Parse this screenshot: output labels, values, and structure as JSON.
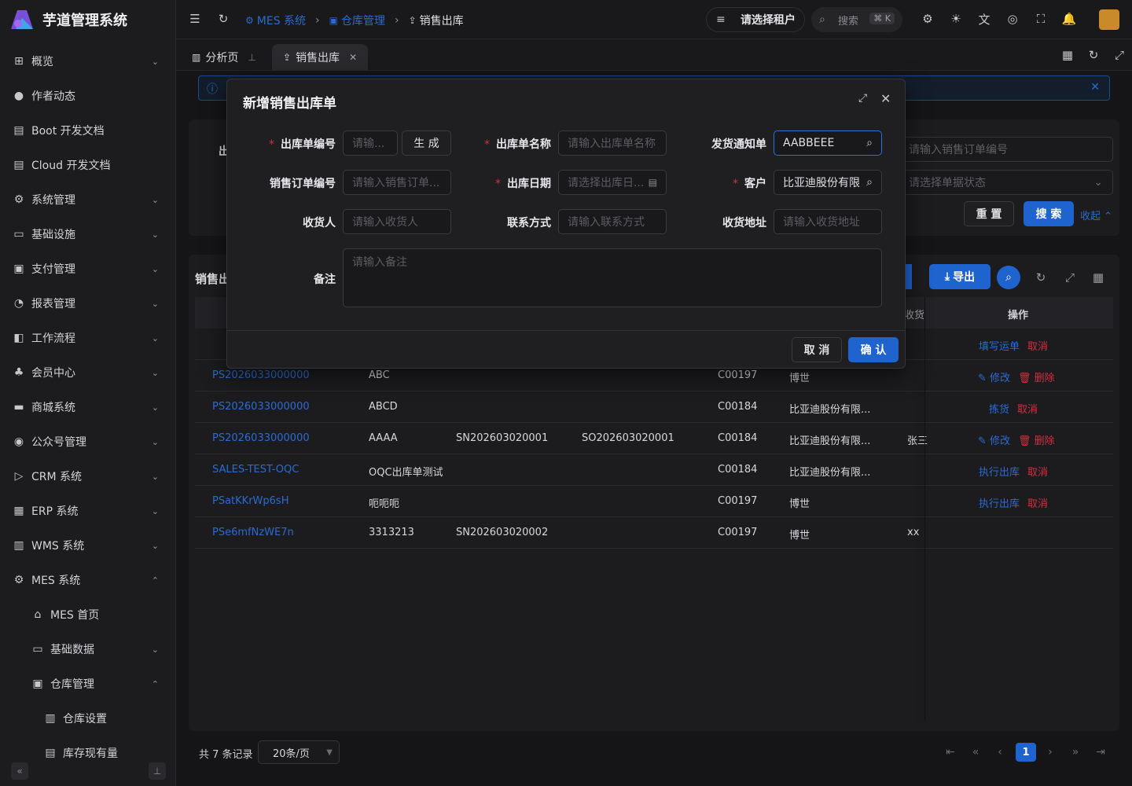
{
  "app": {
    "title": "芋道管理系统"
  },
  "sidebar": {
    "items": [
      {
        "label": "概览",
        "icon": "grid-icon",
        "chev": "⌄"
      },
      {
        "label": "作者动态",
        "icon": "user-icon",
        "chev": ""
      },
      {
        "label": "Boot 开发文档",
        "icon": "doc-icon",
        "chev": ""
      },
      {
        "label": "Cloud 开发文档",
        "icon": "doc-icon",
        "chev": ""
      },
      {
        "label": "系统管理",
        "icon": "gear-icon",
        "chev": "⌄"
      },
      {
        "label": "基础设施",
        "icon": "monitor-icon",
        "chev": "⌄"
      },
      {
        "label": "支付管理",
        "icon": "pay-icon",
        "chev": "⌄"
      },
      {
        "label": "报表管理",
        "icon": "pie-icon",
        "chev": "⌄"
      },
      {
        "label": "工作流程",
        "icon": "flow-icon",
        "chev": "⌄"
      },
      {
        "label": "会员中心",
        "icon": "users-icon",
        "chev": "⌄"
      },
      {
        "label": "商城系统",
        "icon": "shop-icon",
        "chev": "⌄"
      },
      {
        "label": "公众号管理",
        "icon": "compass-icon",
        "chev": "⌄"
      },
      {
        "label": "CRM 系统",
        "icon": "crm-icon",
        "chev": "⌄"
      },
      {
        "label": "ERP 系统",
        "icon": "erp-icon",
        "chev": "⌄"
      },
      {
        "label": "WMS 系统",
        "icon": "box-icon",
        "chev": "⌄"
      },
      {
        "label": "MES 系统",
        "icon": "chip-icon",
        "chev": "⌃"
      },
      {
        "label": "MES 首页",
        "icon": "home-icon",
        "chev": ""
      },
      {
        "label": "基础数据",
        "icon": "board-icon",
        "chev": "⌄"
      },
      {
        "label": "仓库管理",
        "icon": "warehouse-icon",
        "chev": "⌃"
      },
      {
        "label": "仓库设置",
        "icon": "building-icon",
        "chev": ""
      },
      {
        "label": "库存现有量",
        "icon": "doc-icon",
        "chev": ""
      }
    ]
  },
  "topbar": {
    "breadcrumb": [
      "MES 系统",
      "仓库管理",
      "销售出库"
    ],
    "tenant": "请选择租户",
    "search_placeholder": "搜索",
    "search_kbd": "⌘ K"
  },
  "tabs": [
    {
      "label": "分析页"
    },
    {
      "label": "销售出库"
    }
  ],
  "background": {
    "search_label_1": "出",
    "so_placeholder": "请输入销售订单编号",
    "status_placeholder": "请选择单据状态",
    "reset": "重 置",
    "search": "搜 索",
    "collapse": "收起",
    "list_title": "销售出",
    "export": "导出",
    "col_receiver": "收货",
    "col_op": "操作"
  },
  "table": {
    "rows": [
      {
        "code": "",
        "name": "",
        "notice": "",
        "so": "",
        "cust_code": "",
        "cust": "",
        "recv": "",
        "ops": [
          {
            "t": "填写运单",
            "c": "blue"
          },
          {
            "t": "取消",
            "c": "red"
          }
        ]
      },
      {
        "code": "PS2026033000000",
        "name": "ABC",
        "notice": "",
        "so": "",
        "cust_code": "C00197",
        "cust": "博世",
        "recv": "",
        "ops": [
          {
            "t": "✎ 修改",
            "c": "blue"
          },
          {
            "t": "🗑 删除",
            "c": "red"
          }
        ]
      },
      {
        "code": "PS2026033000000",
        "name": "ABCD",
        "notice": "",
        "so": "",
        "cust_code": "C00184",
        "cust": "比亚迪股份有限...",
        "recv": "",
        "ops": [
          {
            "t": "拣货",
            "c": "blue"
          },
          {
            "t": "取消",
            "c": "red"
          }
        ]
      },
      {
        "code": "PS2026033000000",
        "name": "AAAA",
        "notice": "SN202603020001",
        "so": "SO202603020001",
        "cust_code": "C00184",
        "cust": "比亚迪股份有限...",
        "recv": "张三",
        "ops": [
          {
            "t": "✎ 修改",
            "c": "blue"
          },
          {
            "t": "🗑 删除",
            "c": "red"
          }
        ]
      },
      {
        "code": "SALES-TEST-OQC",
        "name": "OQC出库单测试",
        "notice": "",
        "so": "",
        "cust_code": "C00184",
        "cust": "比亚迪股份有限...",
        "recv": "",
        "ops": [
          {
            "t": "执行出库",
            "c": "blue"
          },
          {
            "t": "取消",
            "c": "red"
          }
        ]
      },
      {
        "code": "PSatKKrWp6sH",
        "name": "呃呃呃",
        "notice": "",
        "so": "",
        "cust_code": "C00197",
        "cust": "博世",
        "recv": "",
        "ops": [
          {
            "t": "执行出库",
            "c": "blue"
          },
          {
            "t": "取消",
            "c": "red"
          }
        ]
      },
      {
        "code": "PSe6mfNzWE7n",
        "name": "3313213",
        "notice": "SN202603020002",
        "so": "",
        "cust_code": "C00197",
        "cust": "博世",
        "recv": "xx",
        "ops": []
      }
    ]
  },
  "pager": {
    "total": "共 7 条记录",
    "size": "20条/页",
    "page": "1"
  },
  "modal": {
    "title": "新增销售出库单",
    "code_label": "出库单编号",
    "code_placeholder": "请输...",
    "generate": "生 成",
    "name_label": "出库单名称",
    "name_placeholder": "请输入出库单名称",
    "notice_label": "发货通知单",
    "notice_value": "AABBEEE",
    "so_label": "销售订单编号",
    "so_placeholder": "请输入销售订单...",
    "date_label": "出库日期",
    "date_placeholder": "请选择出库日...",
    "customer_label": "客户",
    "customer_value": "比亚迪股份有限",
    "receiver_label": "收货人",
    "receiver_placeholder": "请输入收货人",
    "contact_label": "联系方式",
    "contact_placeholder": "请输入联系方式",
    "address_label": "收货地址",
    "address_placeholder": "请输入收货地址",
    "remark_label": "备注",
    "remark_placeholder": "请输入备注",
    "cancel": "取 消",
    "confirm": "确 认"
  },
  "colors": {
    "accent": "#1f63cf",
    "danger": "#d0303e",
    "bg": "#151517"
  }
}
